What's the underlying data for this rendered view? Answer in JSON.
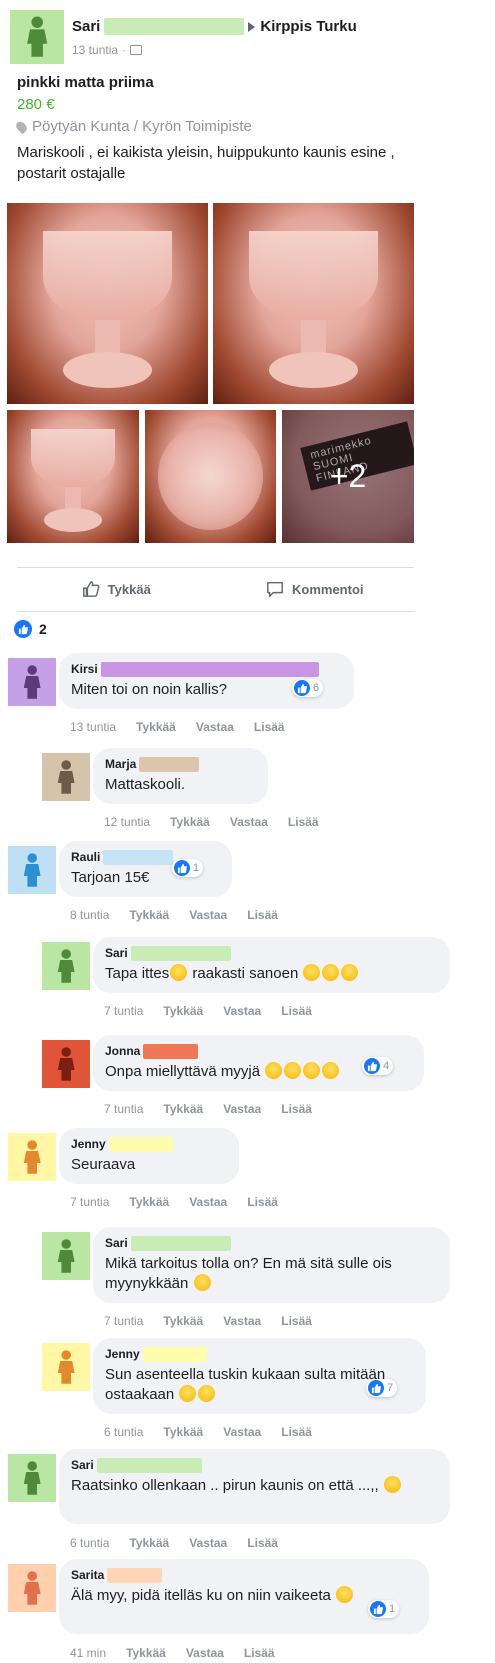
{
  "post": {
    "author_first": "Sari",
    "group": "Kirppis Turku",
    "time": "13 tuntia",
    "title": "pinkki matta priima",
    "price": "280 €",
    "location": "Pöytyän Kunta / Kyrön Toimipiste",
    "text": "Mariskooli , ei kaikista yleisin, huippukunto kaunis esine , postarit ostajalle",
    "more_photos": "+2",
    "tag_text": "marimekko SUOMI FINLAND"
  },
  "actions": {
    "like": "Tykkää",
    "comment": "Kommentoi"
  },
  "reactions": {
    "count": "2"
  },
  "comment_actions": {
    "like": "Tykkää",
    "reply": "Vastaa",
    "more": "Lisää"
  },
  "comments": [
    {
      "name": "Kirsi",
      "text": "Miten toi on noin kallis?",
      "time": "13 tuntia",
      "likes": "6",
      "color": "#c895e3",
      "avatar_color": "#c6a0e6",
      "figure_color": "#5d3b7a"
    },
    {
      "name": "Marja",
      "text": "Mattaskooli.",
      "time": "12 tuntia",
      "color": "#dbc5ab",
      "avatar_color": "#d6c3ab",
      "figure_color": "#6d5b4a"
    },
    {
      "name": "Rauli",
      "text": "Tarjoan 15€",
      "time": "8 tuntia",
      "likes": "1",
      "color": "#c6e2f5",
      "avatar_color": "#bfe0f4",
      "figure_color": "#2c8fd0"
    },
    {
      "name": "Sari",
      "text": "Tapa ittes",
      "text2": " raakasti sanoen",
      "time": "7 tuntia",
      "color": "#c9ecb6",
      "avatar_color": "#b9e6a3",
      "figure_color": "#4f8a3a"
    },
    {
      "name": "Jonna",
      "text": "Onpa miellyttävä myyjä",
      "time": "7 tuntia",
      "likes": "4",
      "color": "#f07755",
      "avatar_color": "#e0543a",
      "figure_color": "#7a1f12"
    },
    {
      "name": "Jenny",
      "text": "Seuraava",
      "time": "7 tuntia",
      "color": "#fffcad",
      "avatar_color": "#fff6a6",
      "figure_color": "#e08a2b"
    },
    {
      "name": "Sari",
      "text": "Mikä tarkoitus tolla on? En mä sitä sulle ois myynykkään",
      "time": "7 tuntia",
      "color": "#c9ecb6",
      "avatar_color": "#b9e6a3",
      "figure_color": "#4f8a3a"
    },
    {
      "name": "Jenny",
      "text": "Sun asenteella tuskin kukaan sulta mitään ostaakaan",
      "time": "6 tuntia",
      "likes": "7",
      "color": "#fffcad",
      "avatar_color": "#fff6a6",
      "figure_color": "#e08a2b"
    },
    {
      "name": "Sari",
      "text": "Raatsinko ollenkaan .. pirun kaunis on että ...,,",
      "time": "6 tuntia",
      "color": "#c9ecb6",
      "avatar_color": "#b9e6a3",
      "figure_color": "#4f8a3a"
    },
    {
      "name": "Sarita",
      "text": "Älä myy, pidä itelläs ku on niin vaikeeta",
      "time": "41 min",
      "likes": "1",
      "color": "#ffd6b5",
      "avatar_color": "#ffcfae",
      "figure_color": "#e0704e"
    }
  ],
  "colors": {
    "accent": "#1877f2",
    "price": "#42b72a",
    "bubble": "#f0f2f5",
    "author_blur": "#c9ecb6"
  },
  "icons": {
    "like": "thumbs-up-icon",
    "comment": "speech-bubble-icon",
    "location": "pin-icon",
    "audience": "group-icon"
  }
}
